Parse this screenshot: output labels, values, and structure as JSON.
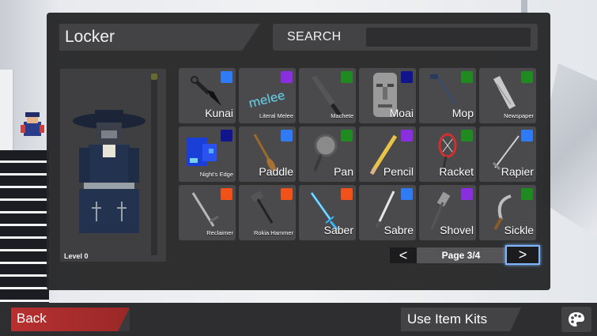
{
  "locker": {
    "title": "Locker",
    "search": {
      "label": "SEARCH",
      "placeholder": ""
    }
  },
  "avatar": {
    "level_label": "Level 0"
  },
  "colors": {
    "blue": "#2f7bf5",
    "purple": "#8a2fe0",
    "green": "#1f8a1f",
    "navy": "#10158c",
    "orange": "#f0521a"
  },
  "items": [
    {
      "name": "Kunai",
      "rarity_color": "#2f7bf5",
      "size": "big",
      "icon": "kunai-icon"
    },
    {
      "name": "Literal Melee",
      "rarity_color": "#8a2fe0",
      "size": "small",
      "icon": "literal-melee-icon"
    },
    {
      "name": "Machete",
      "rarity_color": "#1f8a1f",
      "size": "small",
      "icon": "machete-icon"
    },
    {
      "name": "Moai",
      "rarity_color": "#10158c",
      "size": "big",
      "icon": "moai-icon"
    },
    {
      "name": "Mop",
      "rarity_color": "#1f8a1f",
      "size": "big",
      "icon": "mop-icon"
    },
    {
      "name": "Newspaper",
      "rarity_color": "#1f8a1f",
      "size": "small",
      "icon": "newspaper-icon"
    },
    {
      "name": "Night's Edge",
      "rarity_color": "#10158c",
      "size": "small",
      "icon": "nights-edge-icon"
    },
    {
      "name": "Paddle",
      "rarity_color": "#2f7bf5",
      "size": "big",
      "icon": "paddle-icon"
    },
    {
      "name": "Pan",
      "rarity_color": "#1f8a1f",
      "size": "big",
      "icon": "pan-icon"
    },
    {
      "name": "Pencil",
      "rarity_color": "#8a2fe0",
      "size": "big",
      "icon": "pencil-icon"
    },
    {
      "name": "Racket",
      "rarity_color": "#1f8a1f",
      "size": "big",
      "icon": "racket-icon"
    },
    {
      "name": "Rapier",
      "rarity_color": "#2f7bf5",
      "size": "big",
      "icon": "rapier-icon"
    },
    {
      "name": "Reclaimer",
      "rarity_color": "#f0521a",
      "size": "small",
      "icon": "reclaimer-icon"
    },
    {
      "name": "Rokia Hammer",
      "rarity_color": "#f0521a",
      "size": "small",
      "icon": "hammer-icon"
    },
    {
      "name": "Saber",
      "rarity_color": "#f0521a",
      "size": "big",
      "icon": "saber-icon"
    },
    {
      "name": "Sabre",
      "rarity_color": "#2f7bf5",
      "size": "big",
      "icon": "sabre-icon"
    },
    {
      "name": "Shovel",
      "rarity_color": "#8a2fe0",
      "size": "big",
      "icon": "shovel-icon"
    },
    {
      "name": "Sickle",
      "rarity_color": "#1f8a1f",
      "size": "big",
      "icon": "sickle-icon"
    }
  ],
  "pagination": {
    "prev_symbol": "<",
    "page_label": "Page 3/4",
    "next_symbol": ">"
  },
  "bottom_bar": {
    "back_label": "Back",
    "kits_label": "Use Item Kits",
    "palette_icon": "palette-icon"
  }
}
